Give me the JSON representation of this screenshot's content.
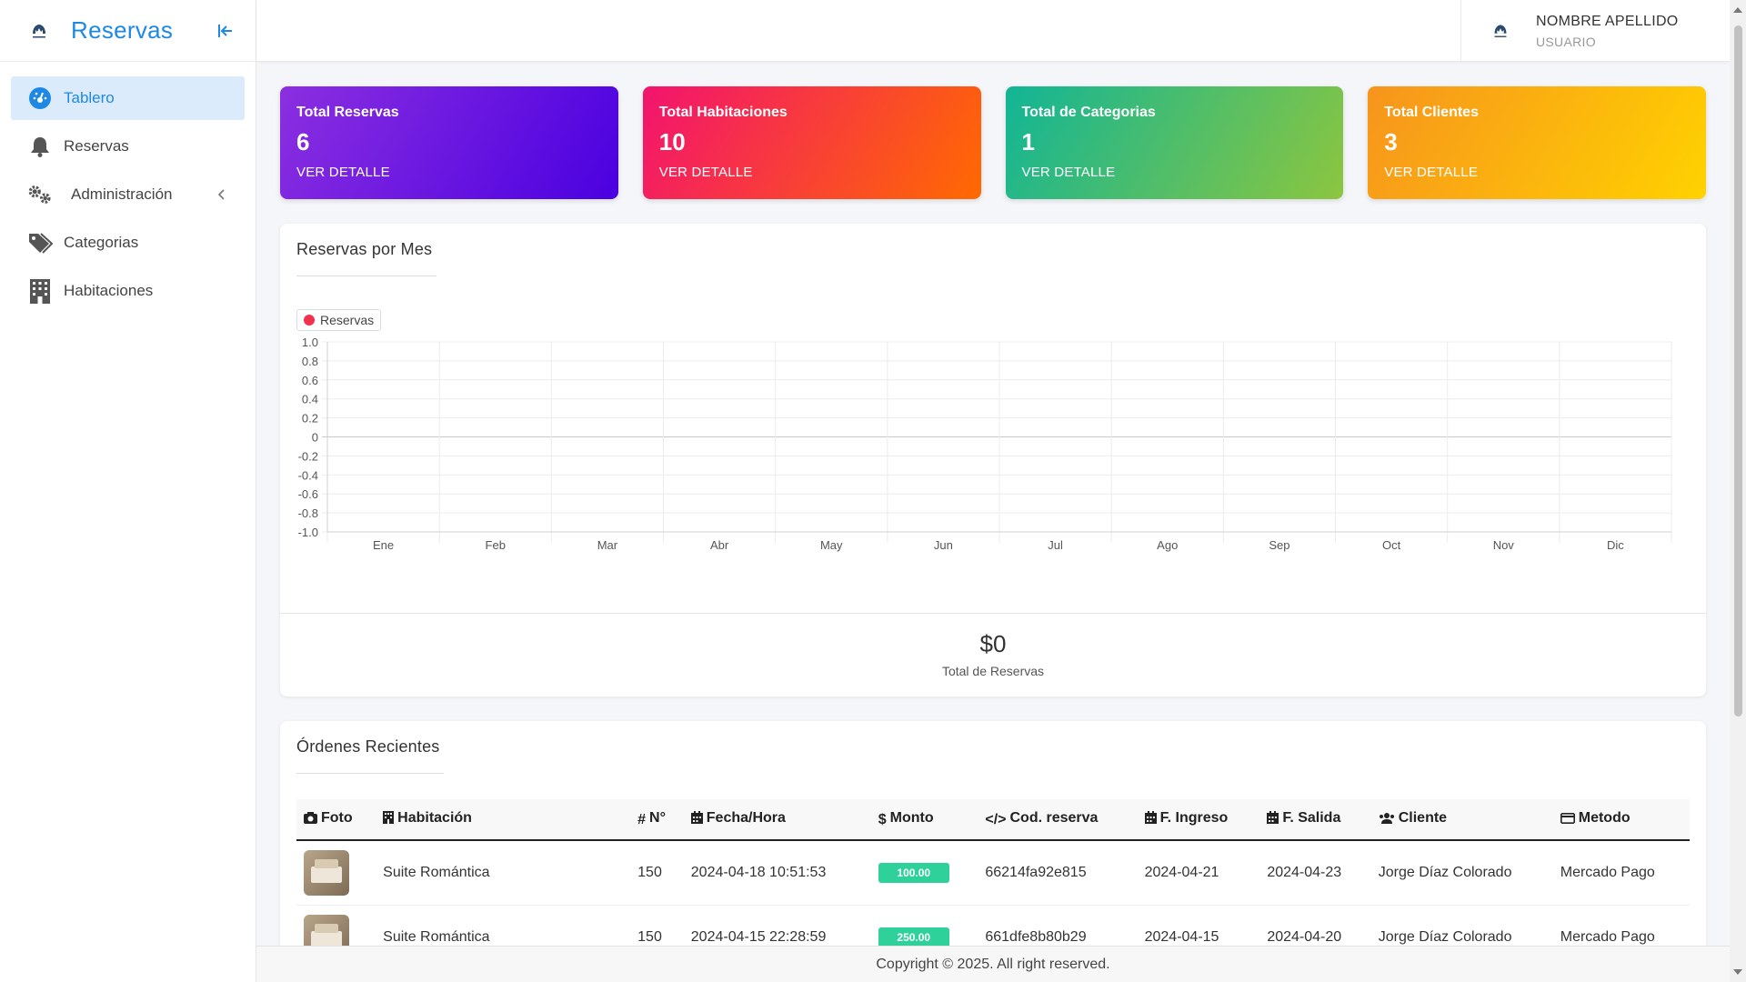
{
  "sidebar": {
    "brand": "Reservas",
    "items": [
      {
        "label": "Tablero",
        "icon": "dashboard-icon",
        "active": true
      },
      {
        "label": "Reservas",
        "icon": "bell-icon"
      },
      {
        "label": "Administración",
        "icon": "gears-icon",
        "has_submenu": true
      },
      {
        "label": "Categorias",
        "icon": "tags-icon"
      },
      {
        "label": "Habitaciones",
        "icon": "building-icon"
      }
    ]
  },
  "user": {
    "name": "NOMBRE APELLIDO",
    "role": "USUARIO"
  },
  "stats": [
    {
      "title": "Total Reservas",
      "value": "6",
      "link": "VER DETALLE",
      "colors": [
        "#8b2fe0",
        "#4a00e0"
      ]
    },
    {
      "title": "Total Habitaciones",
      "value": "10",
      "link": "VER DETALLE",
      "colors": [
        "#f2136f",
        "#ff6a00"
      ]
    },
    {
      "title": "Total de Categorias",
      "value": "1",
      "link": "VER DETALLE",
      "colors": [
        "#11b596",
        "#8cc63f"
      ]
    },
    {
      "title": "Total Clientes",
      "value": "3",
      "link": "VER DETALLE",
      "colors": [
        "#f7941d",
        "#ffd200"
      ]
    }
  ],
  "chart_card": {
    "title": "Reservas por Mes",
    "total_amount": "$0",
    "total_label": "Total de Reservas"
  },
  "chart_data": {
    "type": "line",
    "categories": [
      "Ene",
      "Feb",
      "Mar",
      "Abr",
      "May",
      "Jun",
      "Jul",
      "Ago",
      "Sep",
      "Oct",
      "Nov",
      "Dic"
    ],
    "series": [
      {
        "name": "Reservas",
        "values": [],
        "color": "#f0324f"
      }
    ],
    "ylim": [
      -1.0,
      1.0
    ],
    "yticks": [
      "1.0",
      "0.8",
      "0.6",
      "0.4",
      "0.2",
      "0",
      "-0.2",
      "-0.4",
      "-0.6",
      "-0.8",
      "-1.0"
    ],
    "grid": true,
    "legend": "top-left"
  },
  "orders": {
    "title": "Órdenes Recientes",
    "headers": [
      "Foto",
      "Habitación",
      "N°",
      "Fecha/Hora",
      "Monto",
      "Cod. reserva",
      "F. Ingreso",
      "F. Salida",
      "Cliente",
      "Metodo"
    ],
    "rows": [
      {
        "habitacion": "Suite Romántica",
        "numero": "150",
        "fecha": "2024-04-18 10:51:53",
        "monto": "100.00",
        "codigo": "66214fa92e815",
        "ingreso": "2024-04-21",
        "salida": "2024-04-23",
        "cliente": "Jorge Díaz Colorado",
        "metodo": "Mercado Pago"
      },
      {
        "habitacion": "Suite Romántica",
        "numero": "150",
        "fecha": "2024-04-15 22:28:59",
        "monto": "250.00",
        "codigo": "661dfe8b80b29",
        "ingreso": "2024-04-15",
        "salida": "2024-04-20",
        "cliente": "Jorge Díaz Colorado",
        "metodo": "Mercado Pago"
      }
    ]
  },
  "footer": "Copyright © 2025. All right reserved."
}
